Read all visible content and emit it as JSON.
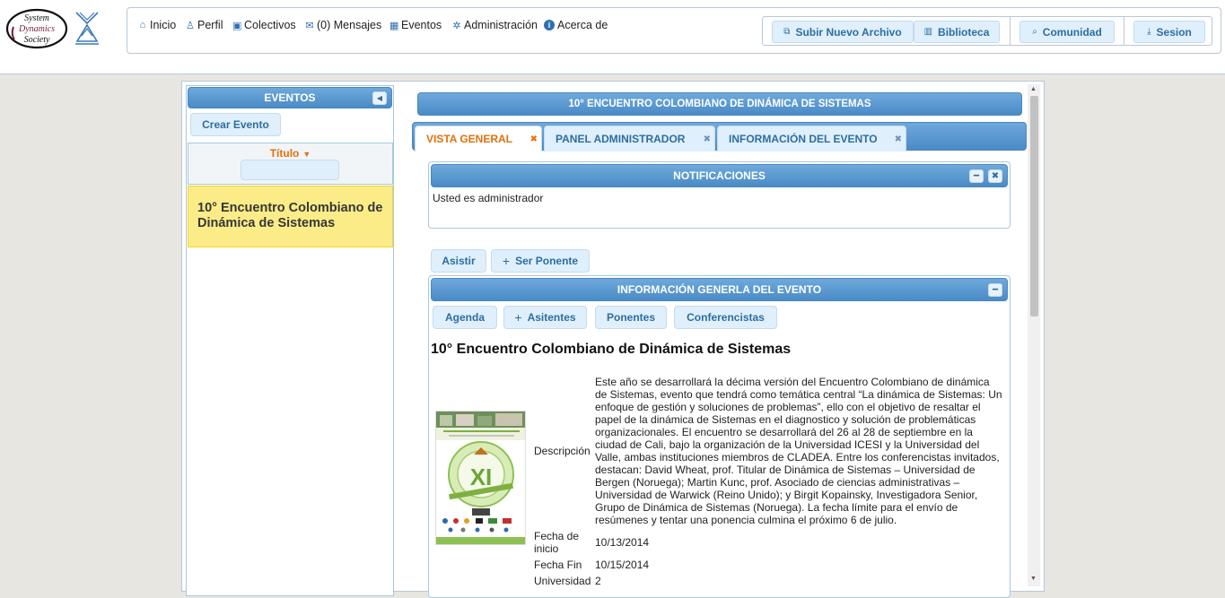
{
  "logos": {
    "sds_text": [
      "System",
      "Dynamics",
      "Society"
    ]
  },
  "nav": {
    "items": [
      {
        "label": "Inicio",
        "icon": "home-icon",
        "glyph": "⌂"
      },
      {
        "label": "Perfil",
        "icon": "user-icon",
        "glyph": "♙"
      },
      {
        "label": "Colectivos",
        "icon": "group-icon",
        "glyph": "▣"
      },
      {
        "label": "(0) Mensajes",
        "icon": "mail-icon",
        "glyph": "✉"
      },
      {
        "label": "Eventos",
        "icon": "calendar-icon",
        "glyph": "▦"
      },
      {
        "label": "Administración",
        "icon": "gear-icon",
        "glyph": "✲"
      },
      {
        "label": "Acerca de",
        "icon": "info-icon",
        "glyph": "i"
      }
    ],
    "actions": {
      "upload": "Subir Nuevo Archivo",
      "library": "Biblioteca",
      "community": "Comunidad",
      "session": "Sesion"
    }
  },
  "events_panel": {
    "title": "EVENTOS",
    "create_button": "Crear Evento",
    "column_title": "Título",
    "rows": [
      "10° Encuentro Colombiano de Dinámica de Sistemas"
    ]
  },
  "event": {
    "title_bar": "10° ENCUENTRO COLOMBIANO DE DINÁMICA DE SISTEMAS",
    "tabs": [
      "VISTA GENERAL",
      "PANEL ADMINISTRADOR",
      "INFORMACIÓN DEL EVENTO"
    ],
    "notifications": {
      "title": "NOTIFICACIONES",
      "text": "Usted es administrador"
    },
    "attend_button": "Asistir",
    "speaker_button": "Ser Ponente",
    "info": {
      "title": "INFORMACIÓN GENERLA DEL EVENTO",
      "buttons": [
        "Agenda",
        "Asitentes",
        "Ponentes",
        "Conferencistas"
      ],
      "heading": "10° Encuentro Colombiano de Dinámica de Sistemas",
      "poster_text": "XI",
      "desc_label": "Descripción",
      "description": "Este año se desarrollará la décima versión del Encuentro Colombiano de dinámica de Sistemas, evento que tendrá como temática central “La dinámica de Sistemas: Un enfoque de gestión y soluciones de problemas”, ello con el objetivo de resaltar el papel de la dinámica de Sistemas en el diagnostico y solución de problemáticas organizacionales. El encuentro se desarrollará del 26 al 28 de septiembre en la ciudad de Cali, bajo la organización de la Universidad ICESI y la Universidad del Valle, ambas instituciones miembros de CLADEA. Entre los conferencistas invitados, destacan: David Wheat, prof. Titular de Dinámica de Sistemas – Universidad de Bergen (Noruega); Martin Kunc, prof. Asociado de ciencias administrativas – Universidad de Warwick (Reino Unido); y Birgit Kopainsky, Investigadora Senior, Grupo de Dinámica de Sistemas (Noruega). La fecha límite para el envío de resúmenes y tentar una ponencia culmina el próximo 6 de julio.",
      "start_label": "Fecha de inicio",
      "start_value": "10/13/2014",
      "end_label": "Fecha Fin",
      "end_value": "10/15/2014",
      "univ_label": "Universidad",
      "univ_value": "2"
    }
  }
}
